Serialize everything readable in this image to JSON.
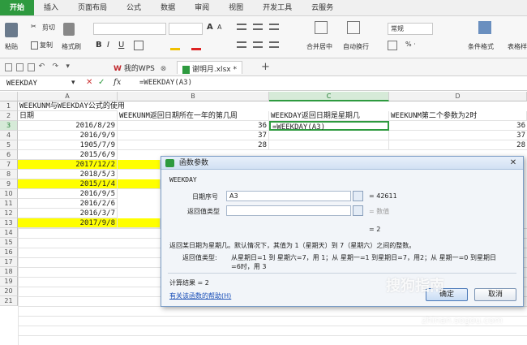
{
  "menubar": {
    "tabs": [
      "开始",
      "插入",
      "页面布局",
      "公式",
      "数据",
      "审阅",
      "视图",
      "开发工具",
      "云服务"
    ],
    "active": 0
  },
  "ribbon": {
    "paste": "粘贴",
    "cut": "剪切",
    "copy": "复制",
    "format_painter": "格式刷",
    "font_size_up": "A",
    "font_size_down": "A",
    "bold": "B",
    "italic": "I",
    "underline": "U",
    "merge": "合并居中",
    "wrap": "自动换行",
    "number_format": "常规",
    "percent": "% ·",
    "cond_format": "条件格式",
    "table_style": "表格样"
  },
  "qat": {
    "wps_tab": "我的WPS",
    "file_tab": "谢明月.xlsx *",
    "add_tab": "+"
  },
  "formula_bar": {
    "name_box": "WEEKDAY",
    "fx": "fx",
    "formula": "=WEEKDAY(A3)"
  },
  "sheet": {
    "columns": [
      "A",
      "B",
      "C",
      "D"
    ],
    "rows": [
      "1",
      "2",
      "3",
      "4",
      "5",
      "6",
      "7",
      "8",
      "9",
      "10",
      "11",
      "12",
      "13",
      "14",
      "15",
      "16",
      "17",
      "18",
      "19",
      "20",
      "21"
    ],
    "r1": "WEEKUNM与WEEKDAY公式的使用",
    "r2": [
      "日期",
      "WEEKUNM返回日期所在一年的第几周",
      "WEEKDAY返回日期是星期几",
      "WEEKUNM第二个参数为2时"
    ],
    "dates": [
      "2016/8/29",
      "2016/9/9",
      "1905/7/9",
      "2015/6/9",
      "2017/12/2",
      "2018/5/3",
      "2015/1/4",
      "2016/9/5",
      "2016/2/6",
      "2016/3/7",
      "2017/9/8"
    ],
    "weeks": [
      "36",
      "37",
      "28"
    ],
    "d_col": [
      "36",
      "37",
      "28"
    ],
    "c3": "=WEEKDAY(A3)"
  },
  "dialog": {
    "title": "函数参数",
    "func_name": "WEEKDAY",
    "arg1_label": "日期序号",
    "arg1_value": "A3",
    "arg1_result": "= 42611",
    "arg2_label": "返回值类型",
    "arg2_result": "= 数值",
    "preview_result": "= 2",
    "description": "返回某日期为星期几。默认情况下，其值为 1（星期天）到 7（星期六）之间的整数。",
    "param_label": "返回值类型:",
    "param_desc_1": "从星期日=1 到 星期六=7，用 1；从 星期一=1 到星期日=7，用2；从 星期一=0 到星期日",
    "param_desc_2": "=6时，用 3",
    "calc_result": "计算结果 = 2",
    "help_link": "有关该函数的帮助(H)",
    "ok": "确定",
    "cancel": "取消"
  },
  "watermark": {
    "text": "搜狗指南",
    "url": "zhinan.sogou.com"
  },
  "colors": {
    "accent": "#2e9a3f",
    "highlight": "#ffff00"
  }
}
